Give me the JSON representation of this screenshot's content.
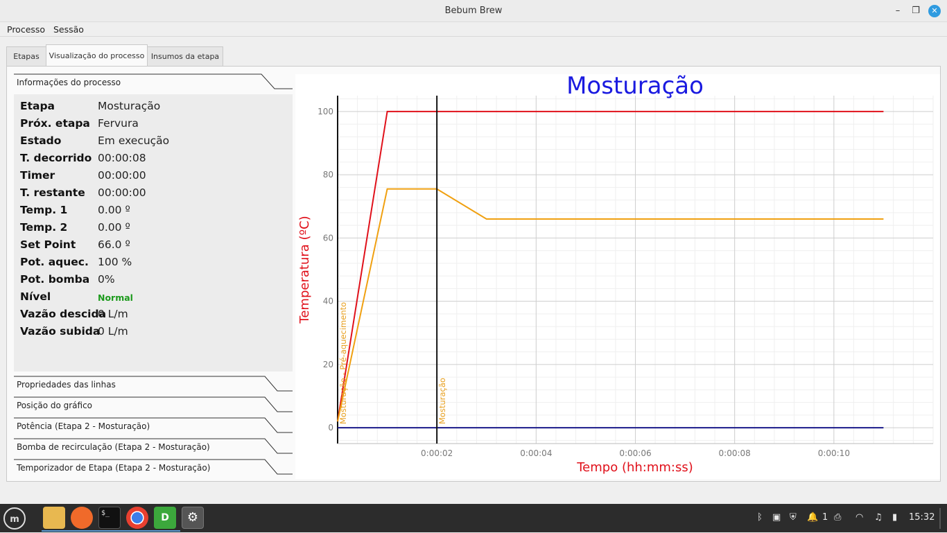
{
  "window": {
    "title": "Bebum Brew"
  },
  "menu": {
    "items": [
      "Processo",
      "Sessão"
    ]
  },
  "tabs": [
    "Etapas",
    "Visualização do processo",
    "Insumos da etapa"
  ],
  "info_section": {
    "header": "Informações do processo",
    "rows": [
      {
        "key": "Etapa",
        "value": "Mosturação"
      },
      {
        "key": "Próx. etapa",
        "value": "Fervura"
      },
      {
        "key": "Estado",
        "value": "Em execução"
      },
      {
        "key": "T. decorrido",
        "value": "00:00:08"
      },
      {
        "key": "Timer",
        "value": "00:00:00"
      },
      {
        "key": "T. restante",
        "value": "00:00:00"
      },
      {
        "key": "Temp. 1",
        "value": "0.00 º"
      },
      {
        "key": "Temp. 2",
        "value": "0.00 º"
      },
      {
        "key": "Set Point",
        "value": "66.0 º"
      },
      {
        "key": "Pot. aquec.",
        "value": "100 %"
      },
      {
        "key": "Pot. bomba",
        "value": "0%"
      },
      {
        "key": "Nível",
        "value": "Normal"
      },
      {
        "key": "Vazão descida",
        "value": "0 L/m"
      },
      {
        "key": "Vazão subida",
        "value": "0 L/m"
      }
    ],
    "status_color": "#1c9a1c"
  },
  "sections": [
    "Propriedades das linhas",
    "Posição do gráfico",
    "Potência (Etapa 2 - Mosturação)",
    "Bomba de recirculação (Etapa 2 - Mosturação)",
    "Temporizador de Etapa (Etapa 2 - Mosturação)"
  ],
  "chart_data": {
    "type": "line",
    "title": "Mosturação",
    "xlabel": "Tempo (hh:mm:ss)",
    "ylabel": "Temperatura (ºC)",
    "xlim": [
      0,
      12
    ],
    "ylim": [
      -5,
      105
    ],
    "x_ticks": [
      "0:00:02",
      "0:00:04",
      "0:00:06",
      "0:00:08",
      "0:00:10"
    ],
    "x_tick_values": [
      2,
      4,
      6,
      8,
      10
    ],
    "y_ticks": [
      0,
      20,
      40,
      60,
      80,
      100
    ],
    "grid": true,
    "series": [
      {
        "color": "#e0101a",
        "x": [
          0,
          1,
          11
        ],
        "y": [
          2,
          100,
          100
        ]
      },
      {
        "color": "#f0a010",
        "x": [
          0,
          1,
          2,
          3,
          11
        ],
        "y": [
          2,
          75.5,
          75.5,
          66,
          66
        ]
      },
      {
        "color": "#1a1a8a",
        "x": [
          0,
          11
        ],
        "y": [
          0,
          0
        ]
      }
    ],
    "markers": [
      {
        "x": 0,
        "label": "Mosturação - Pré-aquecimento"
      },
      {
        "x": 2,
        "label": "Mosturação"
      }
    ],
    "colors": {
      "title": "#1a1ae0",
      "axis_label": "#e0101a",
      "marker_label": "#e8a020"
    }
  },
  "taskbar": {
    "apps": [
      "mint-menu-icon",
      "files-icon",
      "firefox-icon",
      "terminal-icon",
      "chrome-icon",
      "dbeaver-icon",
      "settings-icon"
    ],
    "notifications_count": "1",
    "clock": "15:32"
  }
}
